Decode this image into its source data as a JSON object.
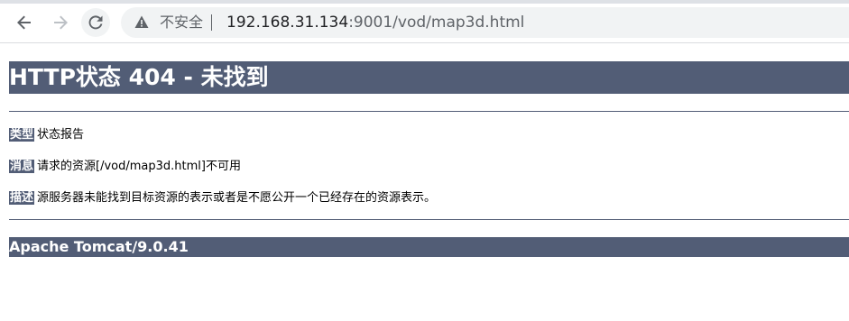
{
  "browser": {
    "back_icon": "arrow-left-icon",
    "forward_icon": "arrow-right-icon",
    "reload_icon": "reload-icon",
    "security_icon": "warning-triangle-icon",
    "security_label": "不安全",
    "url_host": "192.168.31.134",
    "url_rest": ":9001/vod/map3d.html"
  },
  "page": {
    "heading": "HTTP状态 404 - 未找到",
    "rows": [
      {
        "key": "类型",
        "value": "状态报告"
      },
      {
        "key": "消息",
        "value": "请求的资源[/vod/map3d.html]不可用"
      },
      {
        "key": "描述",
        "value": "源服务器未能找到目标资源的表示或者是不愿公开一个已经存在的资源表示。"
      }
    ],
    "footer": "Apache Tomcat/9.0.41"
  },
  "colors": {
    "accent": "#525d76",
    "toolbar_bg": "#f1f3f4"
  }
}
